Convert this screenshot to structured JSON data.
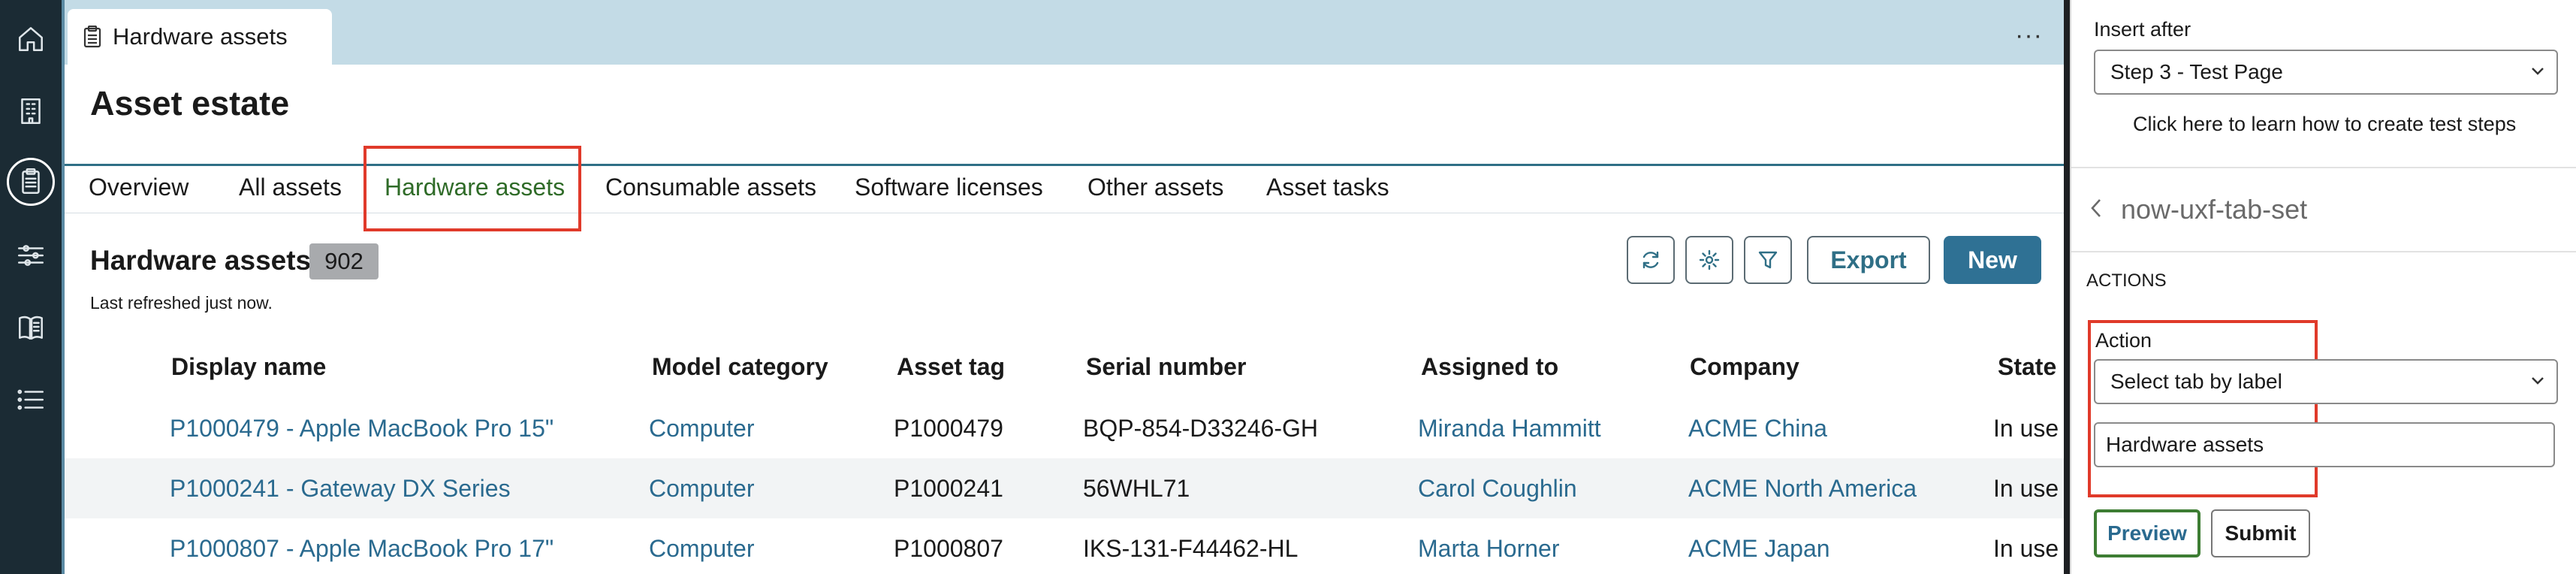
{
  "rail": {
    "icons": [
      "home-icon",
      "building-icon",
      "clipboard-icon",
      "sliders-icon",
      "book-icon",
      "list-icon"
    ]
  },
  "workspace_tab": {
    "label": "Hardware assets",
    "more": "···"
  },
  "page": {
    "title": "Asset estate"
  },
  "tabs": [
    {
      "label": "Overview"
    },
    {
      "label": "All assets"
    },
    {
      "label": "Hardware assets",
      "selected": true
    },
    {
      "label": "Consumable assets"
    },
    {
      "label": "Software licenses"
    },
    {
      "label": "Other assets"
    },
    {
      "label": "Asset tasks"
    }
  ],
  "list": {
    "title": "Hardware assets",
    "count": "902",
    "refreshed": "Last refreshed just now.",
    "export_label": "Export",
    "new_label": "New"
  },
  "table": {
    "headers": [
      "Display name",
      "Model category",
      "Asset tag",
      "Serial number",
      "Assigned to",
      "Company",
      "State"
    ],
    "rows": [
      {
        "name": "P1000479 - Apple MacBook Pro 15\"",
        "category": "Computer",
        "tag": "P1000479",
        "serial": "BQP-854-D33246-GH",
        "assigned": "Miranda Hammitt",
        "company": "ACME China",
        "state": "In use"
      },
      {
        "name": "P1000241 - Gateway DX Series",
        "category": "Computer",
        "tag": "P1000241",
        "serial": "56WHL71",
        "assigned": "Carol Coughlin",
        "company": "ACME North America",
        "state": "In use"
      },
      {
        "name": "P1000807 - Apple MacBook Pro 17\"",
        "category": "Computer",
        "tag": "P1000807",
        "serial": "IKS-131-F44462-HL",
        "assigned": "Marta Horner",
        "company": "ACME Japan",
        "state": "In use"
      }
    ]
  },
  "panel": {
    "insert_after_label": "Insert after",
    "insert_after_value": "Step 3 - Test Page",
    "help_link": "Click here to learn how to create test steps",
    "component": "now-uxf-tab-set",
    "actions_heading": "ACTIONS",
    "action_label": "Action",
    "action_value": "Select tab by label",
    "tab_label_value": "Hardware assets",
    "preview_label": "Preview",
    "submit_label": "Submit"
  },
  "colors": {
    "rail_bg": "#1b2b34",
    "tabstrip_bg": "#c3dbe6",
    "link": "#2a6a8f",
    "selected_tab": "#2f6b28",
    "primary_button": "#2f7194",
    "highlight_box": "#e03a2a"
  }
}
